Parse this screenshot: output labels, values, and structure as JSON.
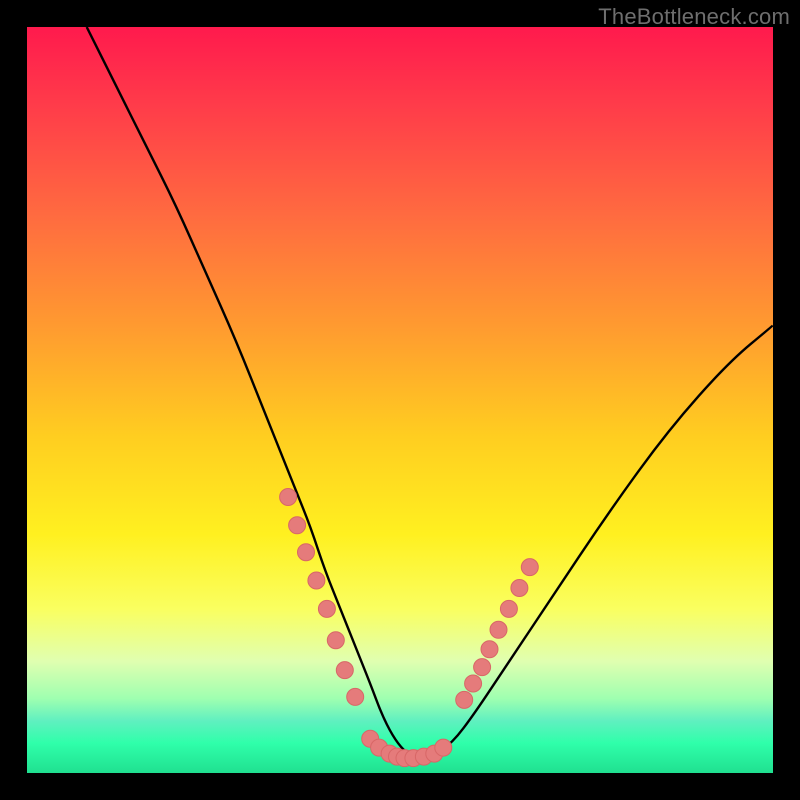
{
  "watermark": "TheBottleneck.com",
  "colors": {
    "page_bg": "#000000",
    "curve_stroke": "#000000",
    "marker_fill": "#e57b7b",
    "marker_stroke": "#d86767",
    "watermark_text": "#6e6e6e"
  },
  "chart_data": {
    "type": "line",
    "title": "",
    "xlabel": "",
    "ylabel": "",
    "xlim": [
      0,
      100
    ],
    "ylim": [
      0,
      100
    ],
    "grid": false,
    "legend": false,
    "series": [
      {
        "name": "bottleneck-curve",
        "x_pct": [
          8,
          12,
          16,
          20,
          24,
          28,
          32,
          36,
          38,
          40,
          42,
          44,
          46,
          47.5,
          49,
          50.5,
          52,
          54,
          57,
          60,
          64,
          70,
          78,
          86,
          94,
          100
        ],
        "y_pct": [
          100,
          92,
          84,
          76,
          67,
          58,
          48,
          38,
          33,
          27,
          22,
          17,
          12,
          8,
          5,
          3,
          2,
          2,
          4,
          8,
          14,
          23,
          35,
          46,
          55,
          60
        ]
      }
    ],
    "markers": {
      "name": "highlight-points",
      "left_cluster_x_pct": [
        35.0,
        36.2,
        37.4,
        38.8,
        40.2,
        41.4,
        42.6,
        44.0
      ],
      "left_cluster_y_pct": [
        37.0,
        33.2,
        29.6,
        25.8,
        22.0,
        17.8,
        13.8,
        10.2
      ],
      "bottom_cluster_x_pct": [
        46.0,
        47.2,
        48.6,
        49.6,
        50.6,
        51.8,
        53.2,
        54.6,
        55.8
      ],
      "bottom_cluster_y_pct": [
        4.6,
        3.4,
        2.6,
        2.2,
        2.0,
        2.0,
        2.2,
        2.6,
        3.4
      ],
      "right_cluster_x_pct": [
        58.6,
        59.8,
        61.0,
        62.0,
        63.2,
        64.6,
        66.0,
        67.4
      ],
      "right_cluster_y_pct": [
        9.8,
        12.0,
        14.2,
        16.6,
        19.2,
        22.0,
        24.8,
        27.6
      ]
    }
  }
}
